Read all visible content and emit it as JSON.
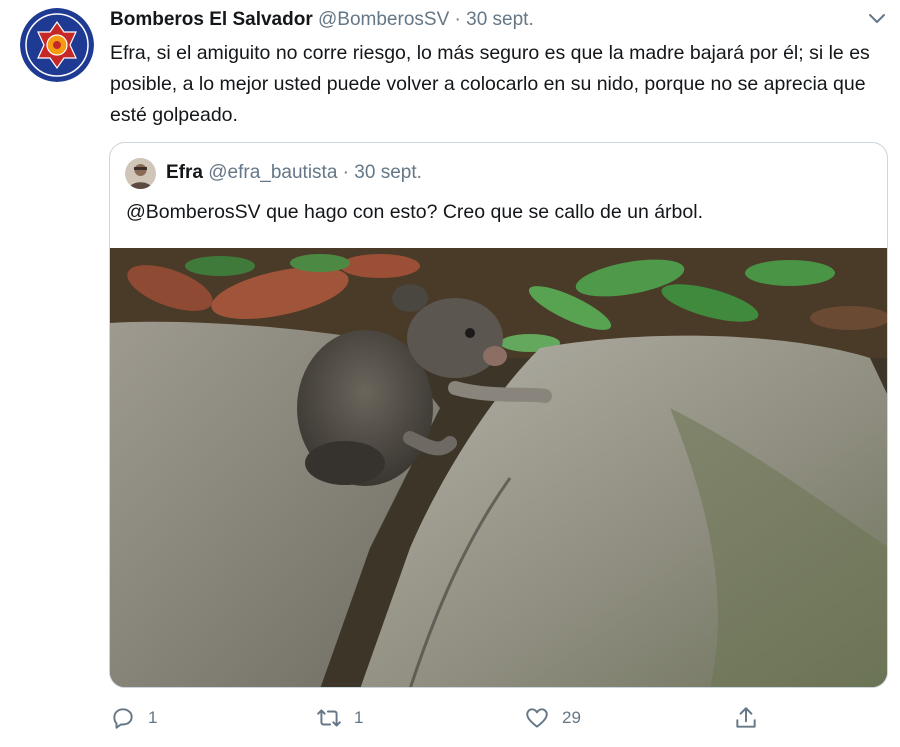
{
  "tweet": {
    "author_name": "Bomberos El Salvador",
    "handle": "@BomberosSV",
    "separator": "·",
    "date": "30 sept.",
    "text": "Efra, si el amiguito no corre riesgo, lo más seguro es que la madre bajará por él; si le es posible, a lo mejor usted puede volver a colocarlo en su nido, porque no se aprecia que esté golpeado."
  },
  "quoted_tweet": {
    "author_name": "Efra",
    "handle": "@efra_bautista",
    "separator": "·",
    "date": "30 sept.",
    "text": "@BomberosSV que hago con esto? Creo que se callo de un árbol."
  },
  "actions": {
    "reply_count": "1",
    "retweet_count": "1",
    "like_count": "29"
  },
  "icons": {
    "more": "chevron-down-icon",
    "reply": "reply-icon",
    "retweet": "retweet-icon",
    "like": "heart-icon",
    "share": "share-icon"
  },
  "colors": {
    "text": "#14171a",
    "secondary": "#657786",
    "border": "#ccd6dd",
    "logo_blue": "#1f3a93",
    "logo_red": "#c62828",
    "logo_orange": "#f39c12"
  }
}
